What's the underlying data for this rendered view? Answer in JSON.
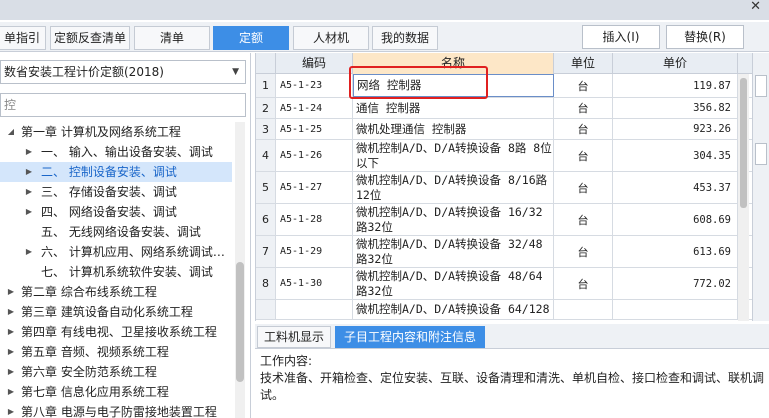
{
  "window": {
    "close_glyph": "✕"
  },
  "tabs": [
    {
      "label": "单指引",
      "active": false
    },
    {
      "label": "定额反查清单",
      "active": false
    },
    {
      "label": "清单",
      "active": false
    },
    {
      "label": "定额",
      "active": true
    },
    {
      "label": "人材机",
      "active": false
    },
    {
      "label": "我的数据",
      "active": false
    }
  ],
  "toolbar": {
    "insert_label": "插入(I)",
    "replace_label": "替换(R)"
  },
  "left": {
    "quota_select": "数省安装工程计价定额(2018)",
    "search_placeholder": "控",
    "tree": [
      {
        "label": "第一章 计算机及网络系统工程",
        "indent": 1,
        "arrow": "open",
        "selected": false
      },
      {
        "label": "一、 输入、输出设备安装、调试",
        "indent": 2,
        "arrow": "closed",
        "selected": false
      },
      {
        "label": "二、 控制设备安装、调试",
        "indent": 2,
        "arrow": "closed",
        "selected": true
      },
      {
        "label": "三、 存储设备安装、调试",
        "indent": 2,
        "arrow": "closed",
        "selected": false
      },
      {
        "label": "四、 网络设备安装、调试",
        "indent": 2,
        "arrow": "closed",
        "selected": false
      },
      {
        "label": "五、 无线网络设备安装、调试",
        "indent": 2,
        "arrow": "none",
        "selected": false
      },
      {
        "label": "六、 计算机应用、网络系统调试…",
        "indent": 2,
        "arrow": "closed",
        "selected": false
      },
      {
        "label": "七、 计算机系统软件安装、调试",
        "indent": 2,
        "arrow": "none",
        "selected": false
      },
      {
        "label": "第二章 综合布线系统工程",
        "indent": 1,
        "arrow": "closed",
        "selected": false
      },
      {
        "label": "第三章 建筑设备自动化系统工程",
        "indent": 1,
        "arrow": "closed",
        "selected": false
      },
      {
        "label": "第四章 有线电视、卫星接收系统工程",
        "indent": 1,
        "arrow": "closed",
        "selected": false
      },
      {
        "label": "第五章 音频、视频系统工程",
        "indent": 1,
        "arrow": "closed",
        "selected": false
      },
      {
        "label": "第六章 安全防范系统工程",
        "indent": 1,
        "arrow": "closed",
        "selected": false
      },
      {
        "label": "第七章 信息化应用系统工程",
        "indent": 1,
        "arrow": "closed",
        "selected": false
      },
      {
        "label": "第八章 电源与电子防雷接地装置工程",
        "indent": 1,
        "arrow": "closed",
        "selected": false
      }
    ]
  },
  "grid": {
    "columns": [
      "编码",
      "名称",
      "单位",
      "单价"
    ],
    "rows": [
      {
        "no": "1",
        "code": "A5-1-23",
        "name": "网络 控制器",
        "unit": "台",
        "price": "119.87"
      },
      {
        "no": "2",
        "code": "A5-1-24",
        "name": "通信 控制器",
        "unit": "台",
        "price": "356.82"
      },
      {
        "no": "3",
        "code": "A5-1-25",
        "name": "微机处理通信 控制器",
        "unit": "台",
        "price": "923.26"
      },
      {
        "no": "4",
        "code": "A5-1-26",
        "name": "微机控制A/D、D/A转换设备 8路 8位以下",
        "unit": "台",
        "price": "304.35"
      },
      {
        "no": "5",
        "code": "A5-1-27",
        "name": "微机控制A/D、D/A转换设备 8/16路12位",
        "unit": "台",
        "price": "453.37"
      },
      {
        "no": "6",
        "code": "A5-1-28",
        "name": "微机控制A/D、D/A转换设备 16/32路32位",
        "unit": "台",
        "price": "608.69"
      },
      {
        "no": "7",
        "code": "A5-1-29",
        "name": "微机控制A/D、D/A转换设备 32/48路32位",
        "unit": "台",
        "price": "613.69"
      },
      {
        "no": "8",
        "code": "A5-1-30",
        "name": "微机控制A/D、D/A转换设备 48/64路32位",
        "unit": "台",
        "price": "772.02"
      },
      {
        "no": "",
        "code": "",
        "name": "微机控制A/D、D/A转换设备 64/128",
        "unit": "",
        "price": ""
      }
    ]
  },
  "bottom": {
    "tabs": [
      {
        "label": "工料机显示",
        "active": false
      },
      {
        "label": "子目工程内容和附注信息",
        "active": true
      }
    ],
    "work_title": "工作内容:",
    "work_text": "技术准备、开箱检查、定位安装、互联、设备清理和清洗、单机自检、接口检查和调试、联机调试。"
  }
}
